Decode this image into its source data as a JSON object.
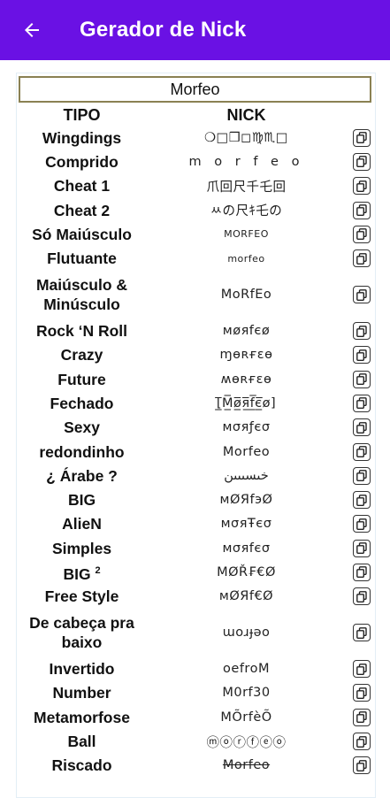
{
  "appbar": {
    "title": "Gerador de Nick",
    "back_icon": "arrow-left-icon",
    "color": "#6a11e4"
  },
  "input": {
    "value": "Morfeo"
  },
  "table": {
    "headers": {
      "tipo": "TIPO",
      "nick": "NICK"
    },
    "rows": [
      {
        "tipo": "Wingdings",
        "nick": "❍□❒◻♍♏□"
      },
      {
        "tipo": "Comprido",
        "nick": "m o r f e o"
      },
      {
        "tipo": "Cheat 1",
        "nick": "爪回尺千乇回"
      },
      {
        "tipo": "Cheat 2",
        "nick": "ﾶの尺ｷ乇の"
      },
      {
        "tipo": "Só Maiúsculo",
        "nick": "MORFEO"
      },
      {
        "tipo": "Flutuante",
        "nick": "morfeo"
      },
      {
        "tipo": "Maiúsculo & Minúsculo",
        "nick": "MoRfEo"
      },
      {
        "tipo": "Rock ‘N Roll",
        "nick": "мøяfєø"
      },
      {
        "tipo": "Crazy",
        "nick": "ɱɵʀғɛɵ"
      },
      {
        "tipo": "Future",
        "nick": "ʍɵʀғɛɵ"
      },
      {
        "tipo": "Fechado",
        "nick": "[̲̅M̲̅ø̲̅я̲̅f̲̅є̲̅ø]"
      },
      {
        "tipo": "Sexy",
        "nick": "мσяƒєσ"
      },
      {
        "tipo": "redondinho",
        "nick": "Morfeo"
      },
      {
        "tipo": "¿ Árabe ?",
        "nick": "خىسىىىن"
      },
      {
        "tipo": "BIG",
        "nick": "мØЯfэØ"
      },
      {
        "tipo": "AlieN",
        "nick": "мσяŦєσ"
      },
      {
        "tipo": "Simples",
        "nick": "мσяfєσ"
      },
      {
        "tipo": "BIG",
        "sup": "2",
        "nick": "MØŘ₣€Ø"
      },
      {
        "tipo": "Free Style",
        "nick": "мØЯf€Ø"
      },
      {
        "tipo": "De cabeça pra baixo",
        "nick": "ɯoɹɟǝo"
      },
      {
        "tipo": "Invertido",
        "nick": "oefroM"
      },
      {
        "tipo": "Number",
        "nick": "M0rf30"
      },
      {
        "tipo": "Metamorfose",
        "nick": "MÕrfèÕ"
      },
      {
        "tipo": "Ball",
        "nick": "ⓜⓞⓡⓕⓔⓞ"
      },
      {
        "tipo": "Riscado",
        "nick": "Morfeo"
      }
    ],
    "copy_icon": "copy-icon"
  }
}
